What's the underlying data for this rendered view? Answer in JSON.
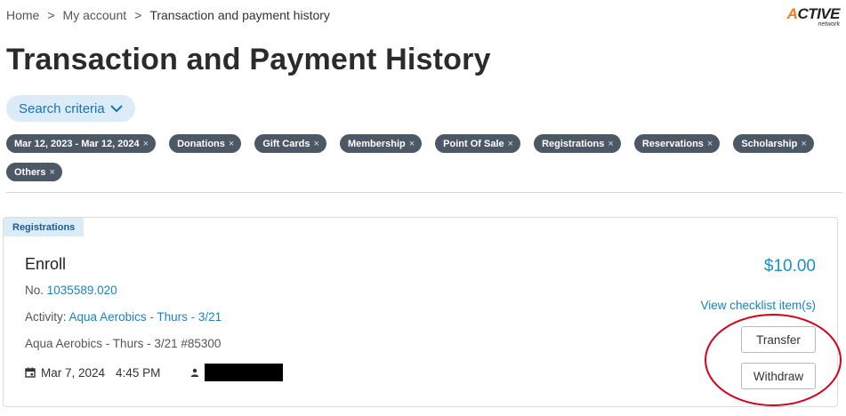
{
  "breadcrumb": {
    "items": [
      "Home",
      "My account"
    ],
    "separator": ">",
    "current": "Transaction and payment history"
  },
  "logo": {
    "main_prefix": "A",
    "main_rest": "CTIVE",
    "sub": "network"
  },
  "page": {
    "title": "Transaction and Payment History"
  },
  "search": {
    "label": "Search criteria",
    "icon": "chevron-down-icon"
  },
  "filters": {
    "row1": [
      {
        "label": "Mar 12, 2023 - Mar 12, 2024"
      },
      {
        "label": "Donations"
      },
      {
        "label": "Gift Cards"
      },
      {
        "label": "Membership"
      },
      {
        "label": "Point Of Sale"
      },
      {
        "label": "Registrations"
      },
      {
        "label": "Reservations"
      },
      {
        "label": "Scholarship"
      }
    ],
    "row2": [
      {
        "label": "Others"
      }
    ],
    "remove_glyph": "×"
  },
  "transaction": {
    "tag": "Registrations",
    "title": "Enroll",
    "number_label": "No.",
    "number_value": "1035589.020",
    "activity_label": "Activity:",
    "activity_value": "Aqua Aerobics - Thurs - 3/21",
    "session": "Aqua Aerobics - Thurs - 3/21 #85300",
    "date": "Mar 7, 2024",
    "time": "4:45 PM",
    "amount": "$10.00",
    "checklist_link": "View checklist item(s)",
    "transfer_label": "Transfer",
    "withdraw_label": "Withdraw"
  },
  "colors": {
    "accent": "#1a82c4",
    "chip_bg": "#4d5866",
    "tag_bg": "#dcebf8",
    "annotation": "#d4001a",
    "logo_accent": "#f47b20"
  }
}
